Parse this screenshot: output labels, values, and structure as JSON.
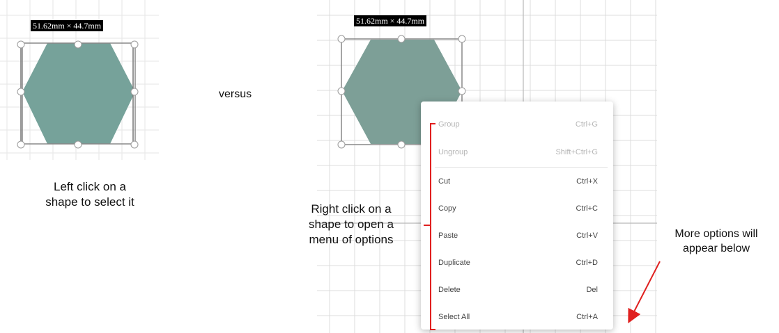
{
  "left_panel": {
    "dimension_label": "51.62mm × 44.7mm",
    "caption_lines": [
      "Left click on a",
      "shape to select it"
    ]
  },
  "versus_text": "versus",
  "right_panel": {
    "dimension_label": "51.62mm × 44.7mm"
  },
  "context_menu": {
    "items": [
      {
        "label": "Group",
        "shortcut": "Ctrl+G",
        "enabled": false
      },
      {
        "label": "Ungroup",
        "shortcut": "Shift+Ctrl+G",
        "enabled": false
      },
      {
        "label": "Cut",
        "shortcut": "Ctrl+X",
        "enabled": true
      },
      {
        "label": "Copy",
        "shortcut": "Ctrl+C",
        "enabled": true
      },
      {
        "label": "Paste",
        "shortcut": "Ctrl+V",
        "enabled": true
      },
      {
        "label": "Duplicate",
        "shortcut": "Ctrl+D",
        "enabled": true
      },
      {
        "label": "Delete",
        "shortcut": "Del",
        "enabled": true
      },
      {
        "label": "Select All",
        "shortcut": "Ctrl+A",
        "enabled": true
      }
    ]
  },
  "annotations": {
    "right_click_lines": [
      "Right  click on a",
      "shape to open a",
      "menu of options"
    ],
    "more_options_lines": [
      "More options will",
      "appear below"
    ]
  },
  "colors": {
    "shape_fill": "#76a29a",
    "shape_fill_right": "#7d9f97",
    "selection_box": "#888888",
    "handle_stroke": "#9a9a9a",
    "grid_line": "#dcdcdc",
    "annotation_red": "#e0201f"
  }
}
